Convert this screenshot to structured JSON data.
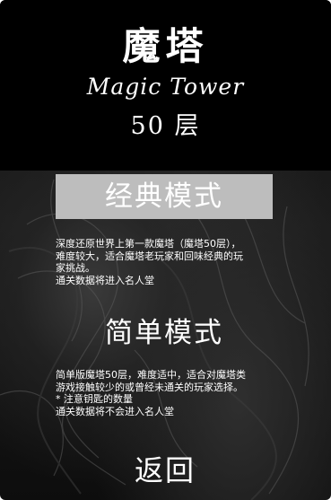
{
  "header": {
    "title_cn": "魔塔",
    "title_en": "Magic Tower",
    "floors": "50 层"
  },
  "modes": {
    "classic": {
      "label": "经典模式",
      "description": [
        "深度还原世界上第一款魔塔（魔塔50层），",
        "难度较大，适合魔塔老玩家和回味经典的玩",
        "家挑战。",
        "通关数据将进入名人堂"
      ]
    },
    "simple": {
      "label": "简单模式",
      "description": [
        "简单版魔塔50层，难度适中，适合对魔塔类",
        "游戏接触较少的或曾经未通关的玩家选择。",
        "* 注意钥匙的数量",
        "通关数据将不会进入名人堂"
      ]
    }
  },
  "back_label": "返回",
  "colors": {
    "header_bg": "#000000",
    "selected_mode_bg": "#bdbdbd",
    "text": "#ffffff"
  }
}
